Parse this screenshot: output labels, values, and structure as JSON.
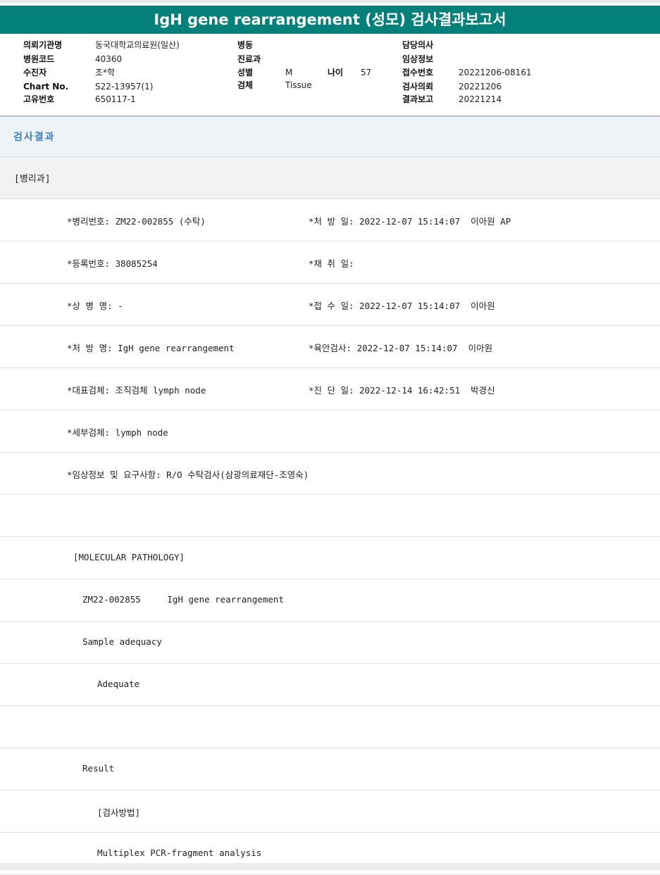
{
  "title": "IgH gene rearrangement (성모) 검사결과보고서",
  "info": {
    "institution_label": "의뢰기관명",
    "institution_value": "동국대학교의료원(일산)",
    "hospital_code_label": "병원코드",
    "hospital_code_value": "40360",
    "patient_label": "수진자",
    "patient_value": "조*학",
    "chart_label": "Chart No.",
    "chart_value": "S22-13957(1)",
    "unique_label": "고유번호",
    "unique_value": "650117-1",
    "ward_label": "병동",
    "dept_label": "진료과",
    "sex_label": "성별",
    "sex_value": "M",
    "age_label": "나이",
    "age_value": "57",
    "specimen_label": "검체",
    "specimen_value": "Tissue",
    "doctor_label": "담당의사",
    "clinical_label": "임상정보",
    "receipt_label": "접수번호",
    "receipt_value": "20221206-08161",
    "request_label": "검사의뢰",
    "request_value": "20221206",
    "report_label": "결과보고",
    "report_value": "20221214"
  },
  "section_title": "검사결과",
  "department": "[병리과]",
  "rows": [
    {
      "left": "*병리번호: ZM22-002855 (수탁)",
      "right": "*처 방 일: 2022-12-07 15:14:07  이아원 AP"
    },
    {
      "left": "*등록번호: 38085254",
      "right": "*채 취 일:"
    },
    {
      "left": "*상 병 명: -",
      "right": "*접 수 일: 2022-12-07 15:14:07  이아원"
    },
    {
      "left": "*처 방 명: IgH gene rearrangement",
      "right": "*육안검사: 2022-12-07 15:14:07  이아원"
    },
    {
      "left": "*대표검체: 조직검체 lymph node",
      "right": "*진 단 일: 2022-12-14 16:42:51  박경신"
    },
    {
      "left": "*세부검체: lymph node",
      "right": ""
    },
    {
      "left": "*임상정보 및 요구사항: R/O 수탁검사(삼광의료재단-조영숙)",
      "right": ""
    },
    {
      "left": "",
      "right": ""
    },
    {
      "left": "[MOLECULAR PATHOLOGY]",
      "right": ""
    },
    {
      "left": "ZM22-002855     IgH gene rearrangement",
      "right": ""
    },
    {
      "left": "Sample adequacy",
      "right": ""
    },
    {
      "left": "Adequate",
      "right": ""
    },
    {
      "left": "",
      "right": ""
    },
    {
      "left": "Result",
      "right": ""
    },
    {
      "left": "[검사방법]",
      "right": ""
    },
    {
      "left": "Multiplex PCR-fragment analysis",
      "right": ""
    }
  ]
}
